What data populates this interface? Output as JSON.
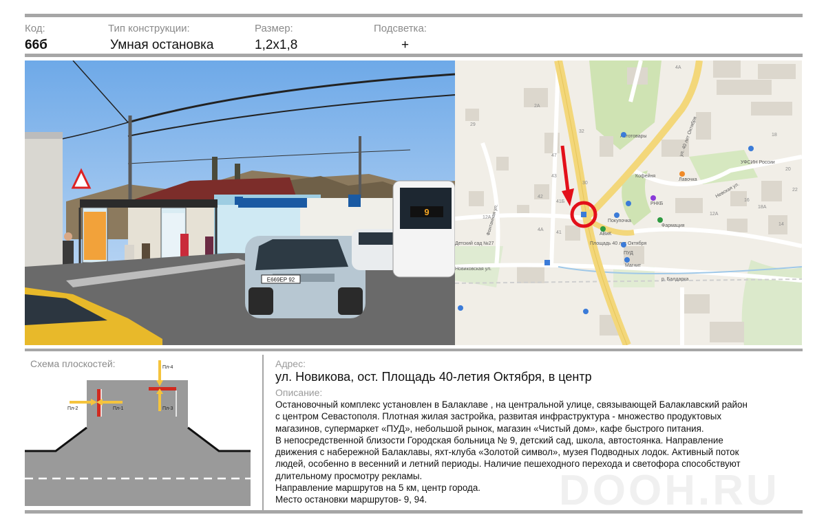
{
  "header": {
    "code_label": "Код:",
    "code_value": "66б",
    "type_label": "Тип конструкции:",
    "type_value": "Умная остановка",
    "size_label": "Размер:",
    "size_value": "1,2х1,8",
    "light_label": "Подсветка:",
    "light_value": "+"
  },
  "photo": {
    "plate": "Е669ЕР 92",
    "bus_number": "9"
  },
  "map": {
    "labels": {
      "street_40let": "ул. 40 лет Октября",
      "square": "Площадь 40 лет Октября",
      "river": "р. Балдарка",
      "nevskaya": "Невская ул.",
      "fontannaya": "Фонтанная ул.",
      "novikova": "Новиковская ул.",
      "pud": "ПУД",
      "pokupochka": "Покупочка",
      "avik": "АВиК",
      "farmaciya": "Фармация",
      "laskovka": "Лавочка",
      "rnkb": "РНКБ",
      "kofe": "Кофейня",
      "ufsin": "УФСИН России",
      "detsad": "Детский сад №27",
      "avtomag": "Автотовары",
      "magnit": "Магнит"
    },
    "houses": [
      "4А",
      "2А",
      "29",
      "32",
      "47",
      "43",
      "41Б",
      "30",
      "12А",
      "4А",
      "41",
      "42",
      "18",
      "20",
      "12А",
      "18А",
      "16",
      "14",
      "22"
    ]
  },
  "scheme": {
    "title": "Схема плоскостей:",
    "planes": [
      "Пл-1",
      "Пл-2",
      "Пл-3",
      "Пл-4"
    ]
  },
  "info": {
    "address_label": "Адрес:",
    "address": "ул. Новикова, ост. Площадь 40-летия Октября, в центр",
    "description_label": "Описание:",
    "description": [
      "Остановочный комплекс установлен в Балаклаве , на  центральной улице, связывающей Балаклавский район",
      "с центром Севастополя. Плотная жилая застройка, развитая инфраструктура -  множество  продуктовых",
      "магазинов, супермаркет «ПУД», небольшой рынок, магазин «Чистый дом», кафе быстрого питания.",
      "В непосредственной близости Городская больница № 9, детский сад, школа, автостоянка.  Направление",
      "движения с набережной Балаклавы, яхт-клуба «Золотой символ», музея Подводных лодок. Активный поток",
      "людей, особенно в весенний и летний периоды.  Наличие пешеходного перехода и светофора способствуют",
      "длительному просмотру рекламы.",
      "Направление маршрутов на 5 км, центр города.",
      "Место остановки маршрутов- 9, 94."
    ]
  },
  "watermark": "DOOH.RU",
  "colors": {
    "separator": "#a6a6a6",
    "marker_red": "#e3101a",
    "road_yellow": "#f3d77a",
    "scheme_gray": "#9a9a9a",
    "plane_red": "#d12a1f",
    "arrow_yellow": "#f5c43d"
  }
}
